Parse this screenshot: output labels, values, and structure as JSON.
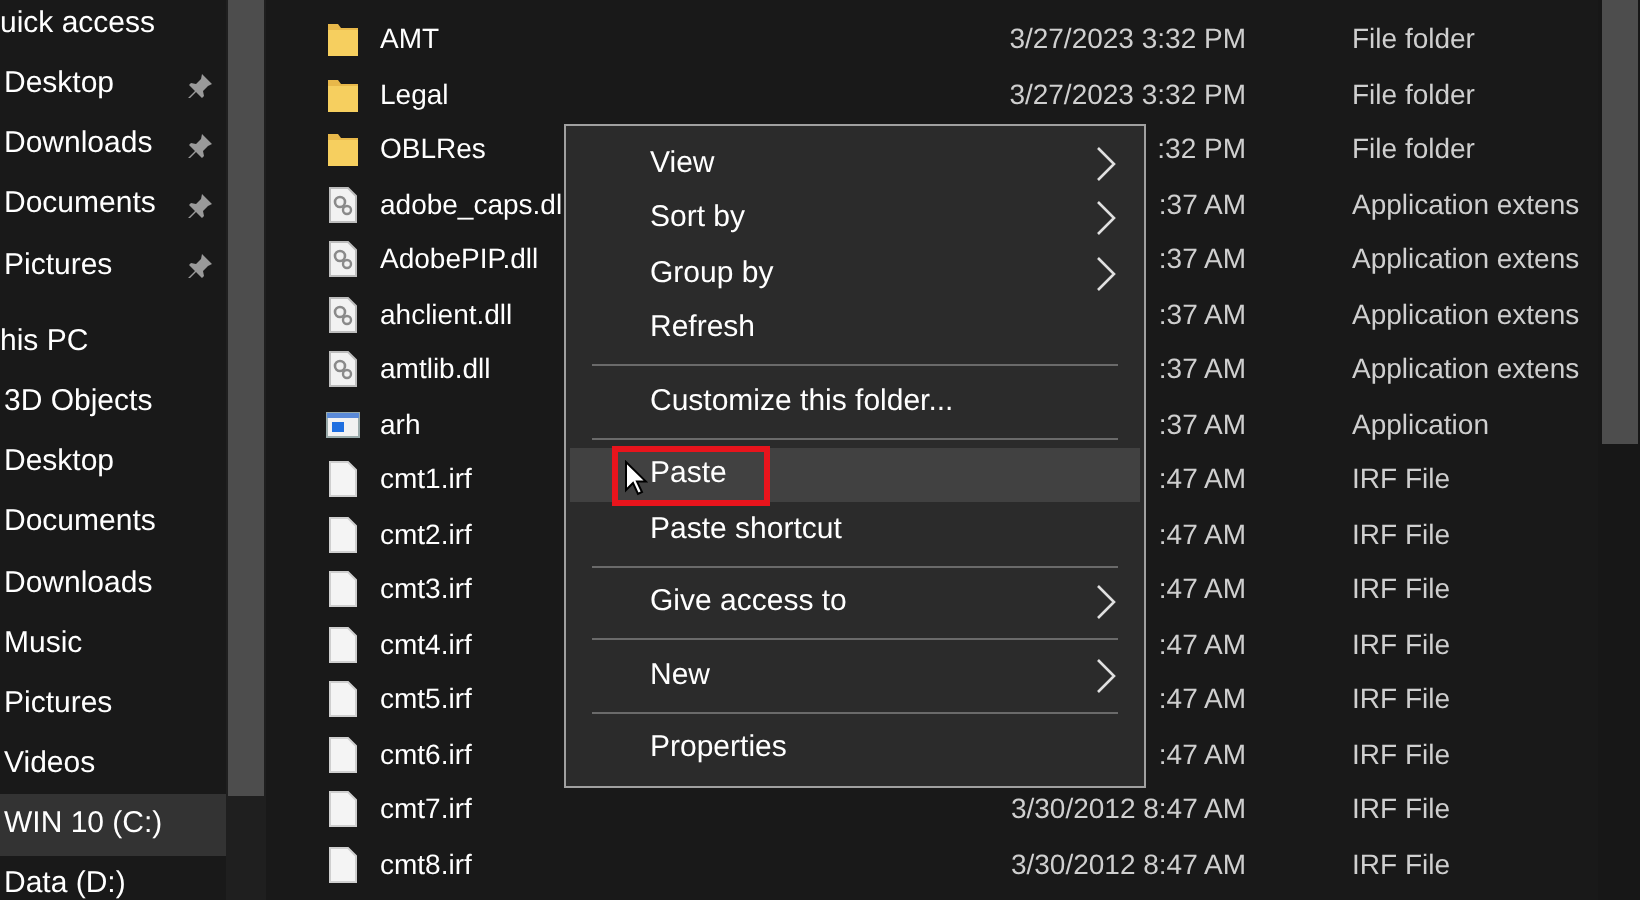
{
  "sidebar": {
    "items": [
      {
        "kind": "heading",
        "label": "uick access",
        "selected": false
      },
      {
        "kind": "item",
        "label": "Desktop",
        "pinned": true,
        "selected": false
      },
      {
        "kind": "item",
        "label": "Downloads",
        "pinned": true,
        "selected": false
      },
      {
        "kind": "item",
        "label": "Documents",
        "pinned": true,
        "selected": false
      },
      {
        "kind": "item",
        "label": "Pictures",
        "pinned": true,
        "selected": false
      },
      {
        "kind": "heading",
        "label": "his PC",
        "selected": false
      },
      {
        "kind": "item",
        "label": "3D Objects",
        "pinned": false,
        "selected": false
      },
      {
        "kind": "item",
        "label": "Desktop",
        "pinned": false,
        "selected": false
      },
      {
        "kind": "item",
        "label": "Documents",
        "pinned": false,
        "selected": false
      },
      {
        "kind": "item",
        "label": "Downloads",
        "pinned": false,
        "selected": false
      },
      {
        "kind": "item",
        "label": "Music",
        "pinned": false,
        "selected": false
      },
      {
        "kind": "item",
        "label": "Pictures",
        "pinned": false,
        "selected": false
      },
      {
        "kind": "item",
        "label": "Videos",
        "pinned": false,
        "selected": false
      },
      {
        "kind": "item",
        "label": "WIN 10 (C:)",
        "pinned": false,
        "selected": true
      },
      {
        "kind": "item",
        "label": "Data (D:)",
        "pinned": false,
        "selected": false
      }
    ]
  },
  "files": {
    "rows": [
      {
        "kind": "folder",
        "name": "AMT",
        "date": "3/27/2023 3:32 PM",
        "type": "File folder"
      },
      {
        "kind": "folder",
        "name": "Legal",
        "date": "3/27/2023 3:32 PM",
        "type": "File folder"
      },
      {
        "kind": "folder",
        "name": "OBLRes",
        "date": ":32 PM",
        "type": "File folder"
      },
      {
        "kind": "dll",
        "name": "adobe_caps.dl",
        "date": ":37 AM",
        "type": "Application extens"
      },
      {
        "kind": "dll",
        "name": "AdobePIP.dll",
        "date": ":37 AM",
        "type": "Application extens"
      },
      {
        "kind": "dll",
        "name": "ahclient.dll",
        "date": ":37 AM",
        "type": "Application extens"
      },
      {
        "kind": "dll",
        "name": "amtlib.dll",
        "date": ":37 AM",
        "type": "Application extens"
      },
      {
        "kind": "app",
        "name": "arh",
        "date": ":37 AM",
        "type": "Application"
      },
      {
        "kind": "file",
        "name": "cmt1.irf",
        "date": ":47 AM",
        "type": "IRF File"
      },
      {
        "kind": "file",
        "name": "cmt2.irf",
        "date": ":47 AM",
        "type": "IRF File"
      },
      {
        "kind": "file",
        "name": "cmt3.irf",
        "date": ":47 AM",
        "type": "IRF File"
      },
      {
        "kind": "file",
        "name": "cmt4.irf",
        "date": ":47 AM",
        "type": "IRF File"
      },
      {
        "kind": "file",
        "name": "cmt5.irf",
        "date": ":47 AM",
        "type": "IRF File"
      },
      {
        "kind": "file",
        "name": "cmt6.irf",
        "date": ":47 AM",
        "type": "IRF File"
      },
      {
        "kind": "file",
        "name": "cmt7.irf",
        "date": "3/30/2012 8:47 AM",
        "type": "IRF File"
      },
      {
        "kind": "file",
        "name": "cmt8.irf",
        "date": "3/30/2012 8:47 AM",
        "type": "IRF File"
      }
    ]
  },
  "context_menu": {
    "items": [
      {
        "kind": "item",
        "label": "View",
        "submenu": true,
        "selected": false,
        "annotated": false
      },
      {
        "kind": "item",
        "label": "Sort by",
        "submenu": true,
        "selected": false,
        "annotated": false
      },
      {
        "kind": "item",
        "label": "Group by",
        "submenu": true,
        "selected": false,
        "annotated": false
      },
      {
        "kind": "item",
        "label": "Refresh",
        "submenu": false,
        "selected": false,
        "annotated": false
      },
      {
        "kind": "separator"
      },
      {
        "kind": "item",
        "label": "Customize this folder...",
        "submenu": false,
        "selected": false,
        "annotated": false
      },
      {
        "kind": "separator"
      },
      {
        "kind": "item",
        "label": "Paste",
        "submenu": false,
        "selected": true,
        "annotated": true
      },
      {
        "kind": "item",
        "label": "Paste shortcut",
        "submenu": false,
        "selected": false,
        "annotated": false
      },
      {
        "kind": "separator"
      },
      {
        "kind": "item",
        "label": "Give access to",
        "submenu": true,
        "selected": false,
        "annotated": false
      },
      {
        "kind": "separator"
      },
      {
        "kind": "item",
        "label": "New",
        "submenu": true,
        "selected": false,
        "annotated": false
      },
      {
        "kind": "separator"
      },
      {
        "kind": "item",
        "label": "Properties",
        "submenu": false,
        "selected": false,
        "annotated": false
      }
    ]
  }
}
